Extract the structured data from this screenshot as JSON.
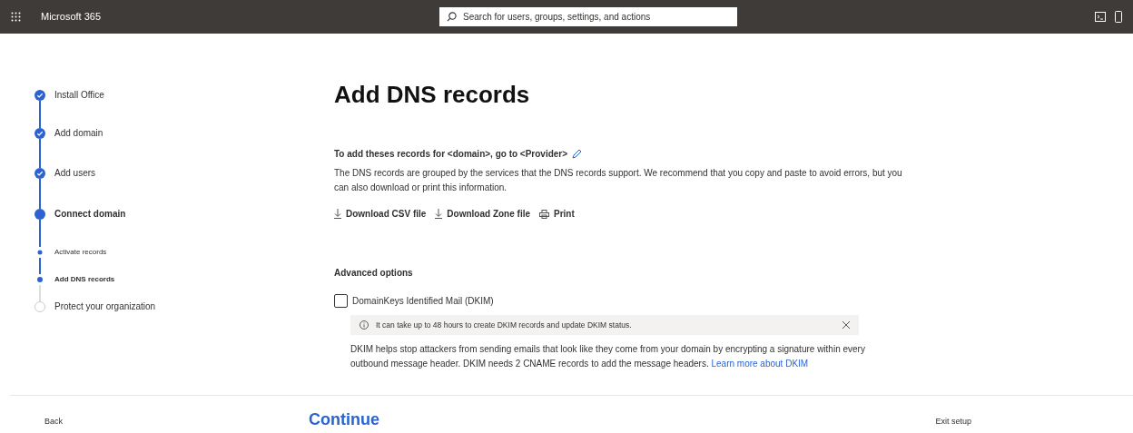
{
  "topbar": {
    "app_name": "Microsoft 365",
    "search": {
      "placeholder": "Search for users, groups, settings, and actions"
    }
  },
  "steps": [
    {
      "label": "Install Office",
      "kind": "main",
      "completed": true,
      "current": false
    },
    {
      "label": "Add domain",
      "kind": "main",
      "completed": true,
      "current": false
    },
    {
      "label": "Add users",
      "kind": "main",
      "completed": true,
      "current": false
    },
    {
      "label": "Connect domain",
      "kind": "main",
      "completed": false,
      "current": true
    },
    {
      "label": "Activate records",
      "kind": "sub",
      "completed": true,
      "current": false
    },
    {
      "label": "Add DNS records",
      "kind": "sub",
      "completed": false,
      "current": true
    },
    {
      "label": "Protect your organization",
      "kind": "main",
      "completed": false,
      "current": false
    }
  ],
  "title": "Add DNS records",
  "provider_line": "To add theses records for <domain>, go to <Provider>",
  "description": "The DNS records are grouped by the services that the DNS records support. We recommend that you copy and paste to avoid errors, but you can also download or print this information.",
  "actions": [
    {
      "label": "Download CSV file",
      "kind": "download"
    },
    {
      "label": "Download Zone file",
      "kind": "download"
    },
    {
      "label": "Print",
      "kind": "print"
    }
  ],
  "advanced": {
    "heading": "Advanced options",
    "checkbox": {
      "label": "DomainKeys Identified Mail (DKIM)",
      "checked": false
    },
    "notice": "It can take up to 48 hours to create DKIM records and update DKIM status.",
    "info": "DKIM helps stop attackers from sending emails that look like they come from your domain by encrypting a signature within every outbound message header. DKIM needs 2 CNAME records to add the message headers.",
    "link": "Learn more about DKIM"
  },
  "footer": {
    "back": "Back",
    "continue": "Continue",
    "exit": "Exit setup"
  }
}
